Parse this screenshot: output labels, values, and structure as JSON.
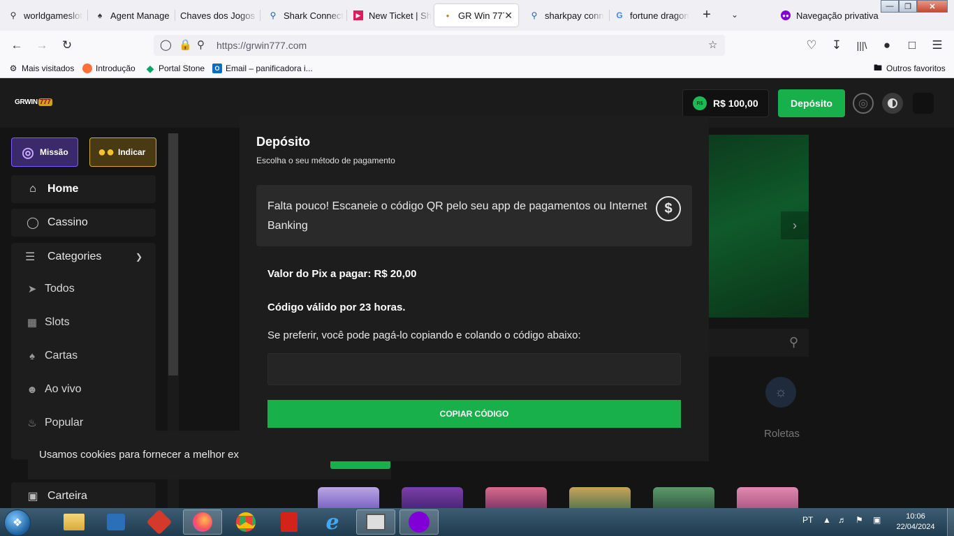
{
  "browser": {
    "tabs": [
      {
        "label": "worldgameslot",
        "icon": "search-icon"
      },
      {
        "label": "Agent Manage",
        "icon": "spade-icon"
      },
      {
        "label": "Chaves dos Jogos -",
        "icon": "blank-icon"
      },
      {
        "label": "Shark Connect",
        "icon": "search-icon"
      },
      {
        "label": "New Ticket | Sh",
        "icon": "ticket-icon"
      },
      {
        "label": "GR Win 777",
        "icon": "site-icon",
        "active": true
      },
      {
        "label": "sharkpay conn",
        "icon": "search-icon"
      },
      {
        "label": "fortune dragon",
        "icon": "google-icon"
      }
    ],
    "private_label": "Navegação privativa",
    "url": "https://grwin777.com",
    "bookmarks": [
      {
        "label": "Mais visitados",
        "icon": "gear-icon"
      },
      {
        "label": "Introdução",
        "icon": "firefox-icon"
      },
      {
        "label": "Portal Stone",
        "icon": "stone-icon"
      },
      {
        "label": "Email – panificadora i...",
        "icon": "outlook-icon"
      }
    ],
    "other_bookmarks": "Outros favoritos"
  },
  "site": {
    "logo_text": "GRWIN",
    "logo_badge": "777",
    "balance_currency": "R$",
    "balance": "R$ 100,00",
    "deposit_button": "Depósito",
    "missions": "Missão",
    "indicate": "Indicar",
    "nav": {
      "home": "Home",
      "casino": "Cassino",
      "categories": "Categories",
      "wallet": "Carteira"
    },
    "categories": [
      {
        "label": "Todos",
        "icon": "rocket-icon"
      },
      {
        "label": "Slots",
        "icon": "slot-machine-icon"
      },
      {
        "label": "Cartas",
        "icon": "cards-icon"
      },
      {
        "label": "Ao vivo",
        "icon": "live-dealer-icon"
      },
      {
        "label": "Popular",
        "icon": "fire-icon"
      }
    ],
    "category_right_label": "Roletas",
    "category_partial_label": "r",
    "cookie_text": "Usamos cookies para fornecer a melhor expe"
  },
  "modal": {
    "title": "Depósito",
    "subtitle": "Escolha o seu método de pagamento",
    "info": "Falta pouco! Escaneie o código QR pelo seu app de pagamentos ou Internet Banking",
    "amount": "Valor do Pix a pagar: R$ 20,00",
    "validity": "Código válido por 23 horas.",
    "hint": "Se preferir, você pode pagá-lo copiando e colando o código abaixo:",
    "code_value": "",
    "copy_button": "COPIAR CÓDIGO"
  },
  "taskbar": {
    "language": "PT",
    "time": "10:06",
    "date": "22/04/2024"
  },
  "colors": {
    "accent_green": "#17b04a",
    "surface": "#1d1d1d",
    "background": "#141414"
  }
}
